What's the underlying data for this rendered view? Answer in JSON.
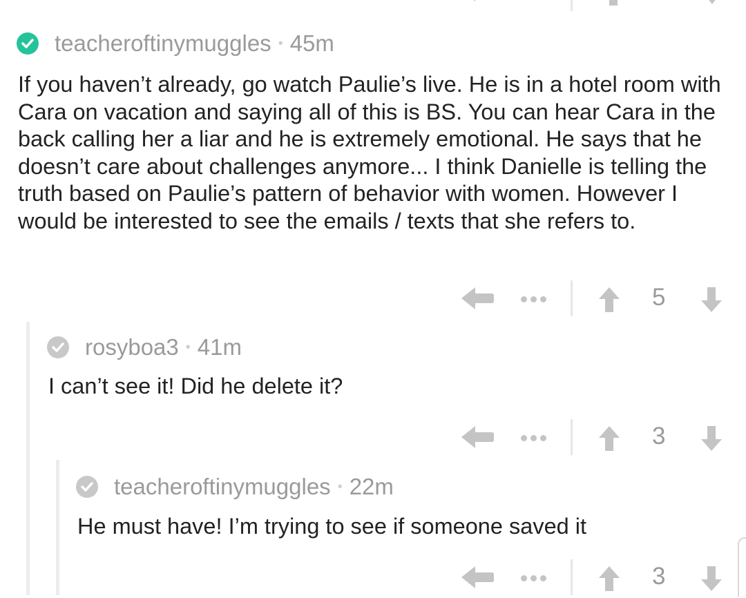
{
  "comments": [
    {
      "username": "teacheroftinymuggles",
      "age": "45m",
      "verified_color": "#26c39a",
      "icon": "checkmark-icon",
      "text": "If you haven’t already, go watch Paulie’s live. He is in a hotel room with Cara on vacation and saying all of this is BS. You can hear Cara in the back calling her a liar and he is extremely emotional. He says that he doesn’t care about challenges anymore... I think Danielle is telling the truth based on Paulie’s pattern of behavior with women. However I would be interested to see the emails / texts that she refers to.",
      "score": "5"
    },
    {
      "username": "rosyboa3",
      "age": "41m",
      "verified_color": "#c8c8c8",
      "icon": "checkmark-icon",
      "text": "I can’t see it! Did he delete it?",
      "score": "3"
    },
    {
      "username": "teacheroftinymuggles",
      "age": "22m",
      "verified_color": "#c8c8c8",
      "icon": "checkmark-icon",
      "text": "He must have! I’m trying to see if someone saved it",
      "score": "3"
    }
  ],
  "separator": "•",
  "icons": {
    "reply": "reply-arrow-icon",
    "more": "more-dots-icon",
    "upvote": "upvote-arrow-icon",
    "downvote": "downvote-arrow-icon"
  },
  "colors": {
    "meta_text": "#9a9a9a",
    "body_text": "#222222",
    "action_icon": "#c4c4c4",
    "thread_line": "#ececec"
  }
}
